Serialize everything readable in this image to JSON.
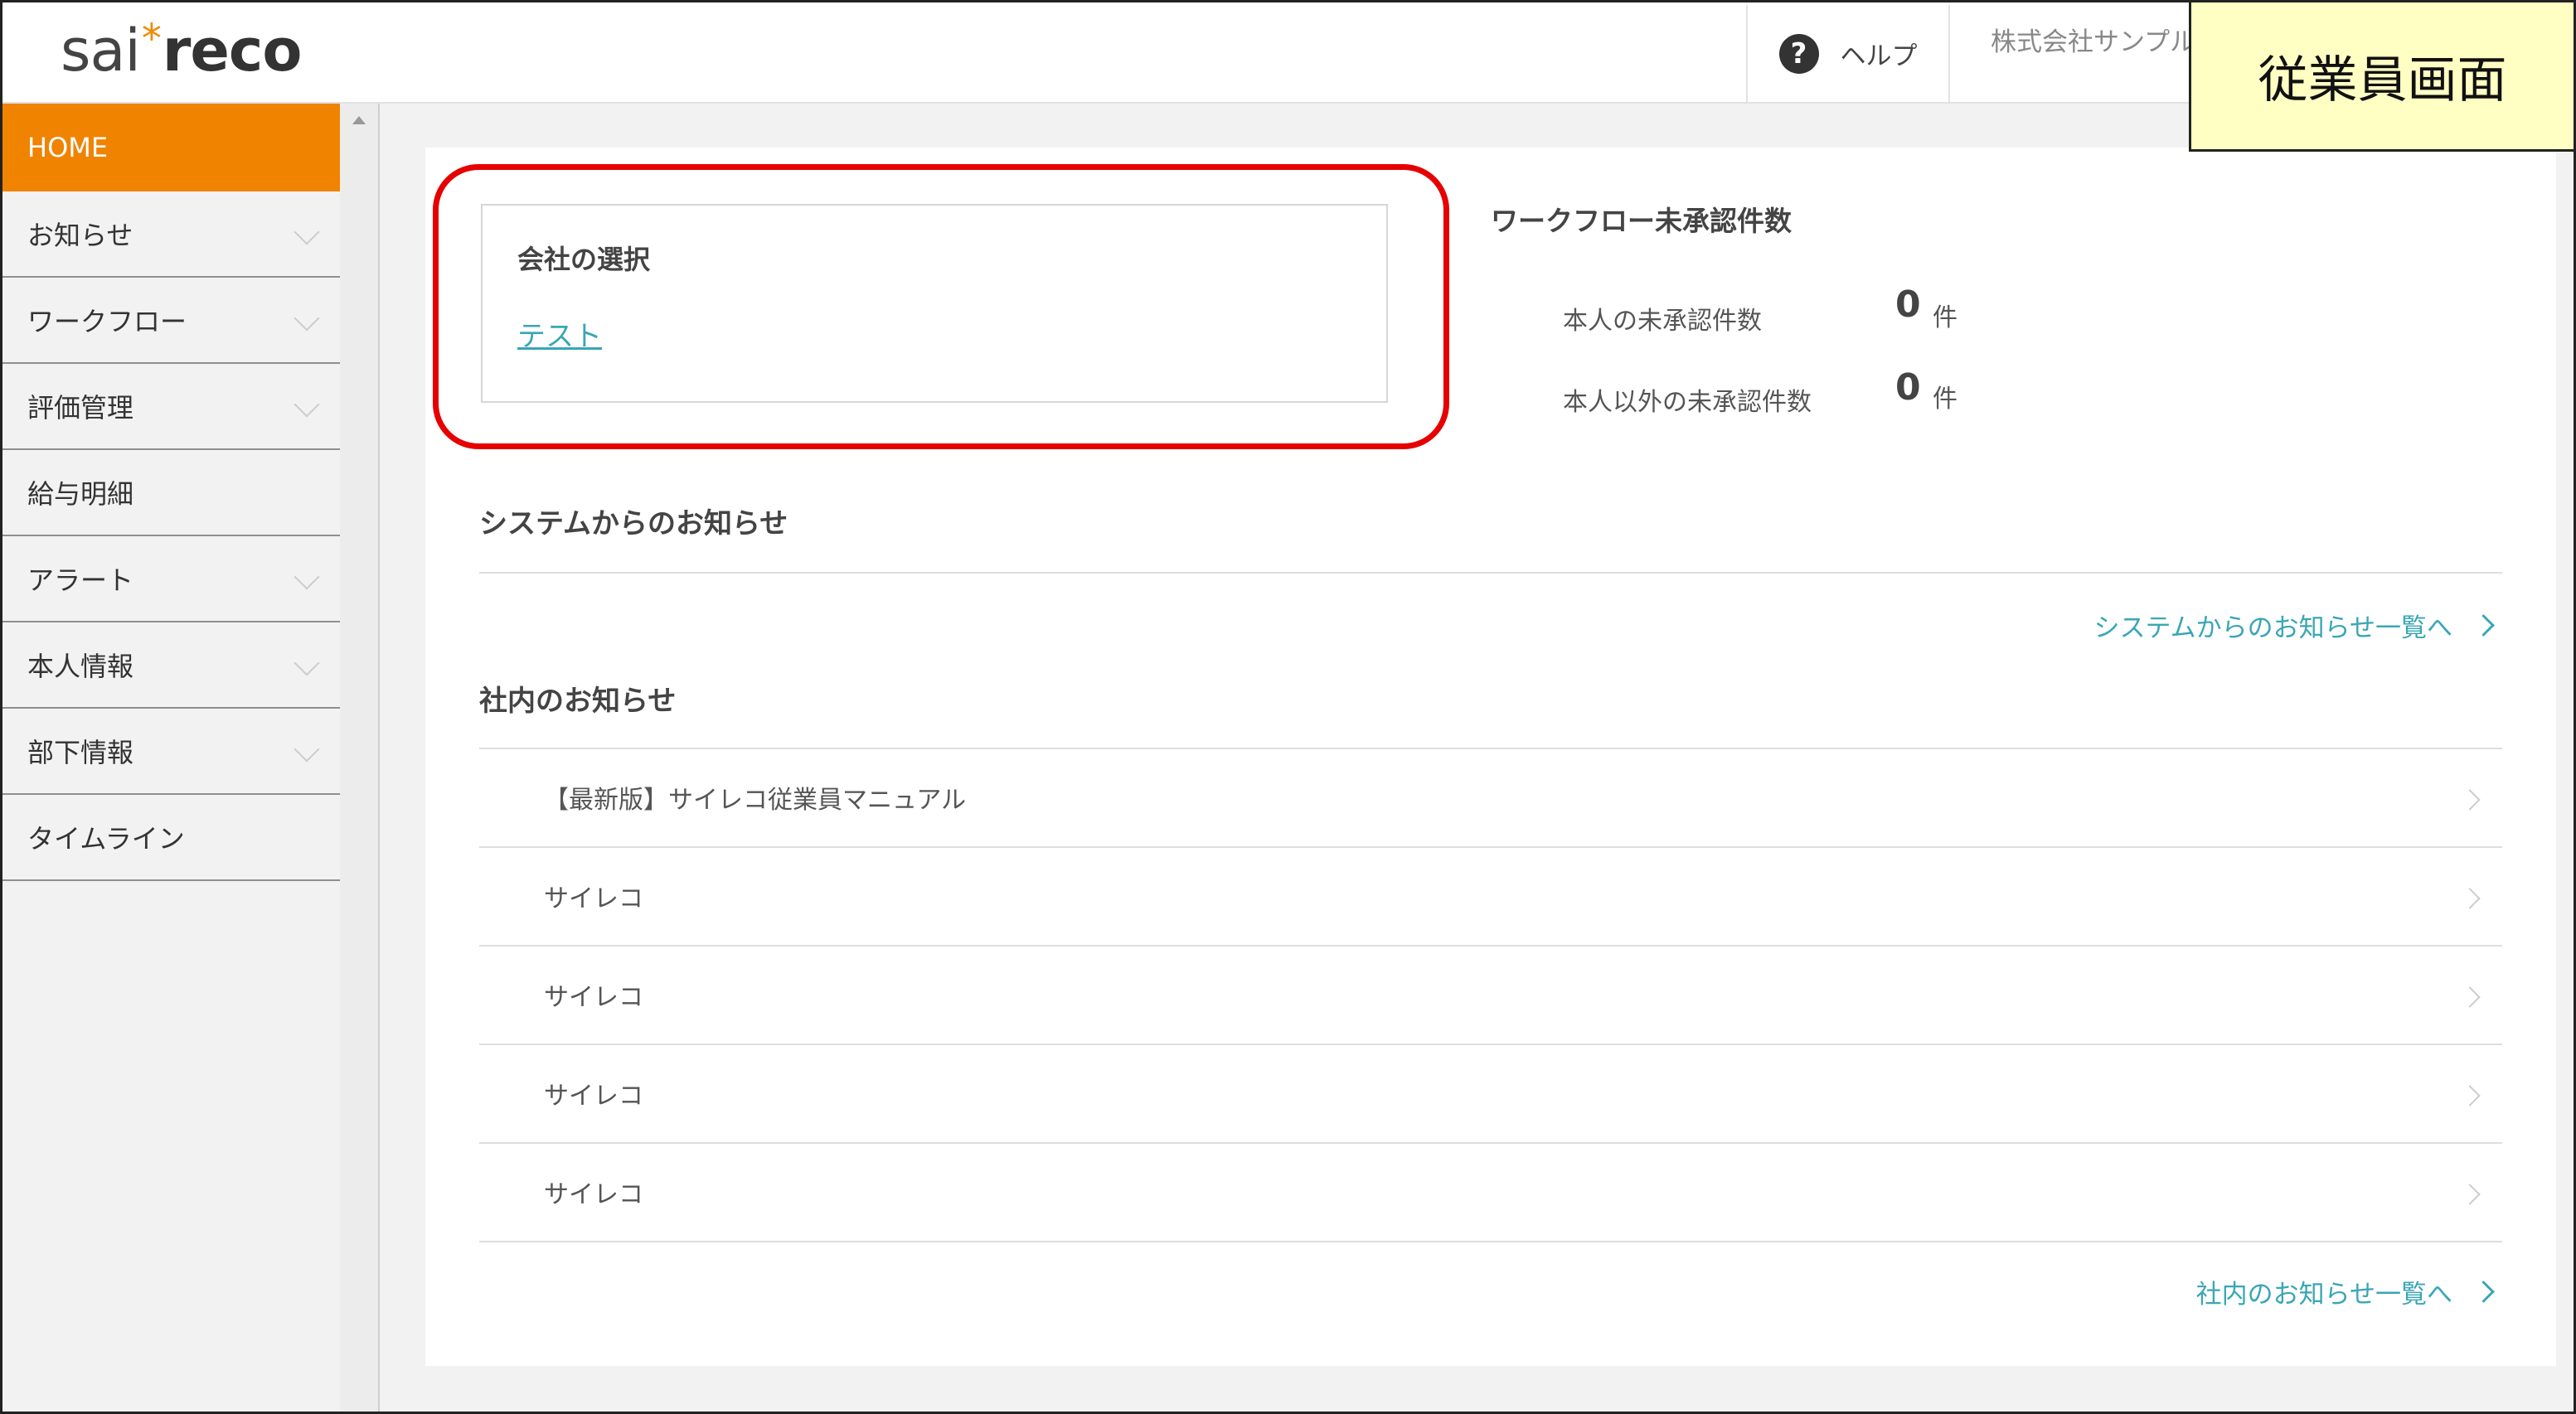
{
  "header": {
    "logo_part1": "sai",
    "logo_star": "*",
    "logo_part2": "reco",
    "help_label": "ヘルプ",
    "company_name": "株式会社サンプル",
    "screen_badge": "従業員画面"
  },
  "sidebar": {
    "items": [
      {
        "label": "HOME",
        "active": true
      },
      {
        "label": "お知らせ",
        "expandable": true
      },
      {
        "label": "ワークフロー",
        "expandable": true
      },
      {
        "label": "評価管理",
        "expandable": true
      },
      {
        "label": "給与明細",
        "expandable": false
      },
      {
        "label": "アラート",
        "expandable": true
      },
      {
        "label": "本人情報",
        "expandable": true
      },
      {
        "label": "部下情報",
        "expandable": true
      },
      {
        "label": "タイムライン",
        "expandable": false
      }
    ]
  },
  "company_select": {
    "title": "会社の選択",
    "company_link": "テスト"
  },
  "workflow": {
    "title": "ワークフロー未承認件数",
    "self_label": "本人の未承認件数",
    "self_count": "0",
    "others_label": "本人以外の未承認件数",
    "others_count": "0",
    "unit": "件"
  },
  "system_notices": {
    "title": "システムからのお知らせ",
    "more_link": "システムからのお知らせ一覧へ"
  },
  "internal_notices": {
    "title": "社内のお知らせ",
    "items": [
      "【最新版】サイレコ従業員マニュアル",
      "サイレコ",
      "サイレコ",
      "サイレコ",
      "サイレコ"
    ],
    "more_link": "社内のお知らせ一覧へ"
  },
  "colors": {
    "accent": "#f08300",
    "link": "#3aa6b5",
    "highlight": "#e60000",
    "badge_bg": "#ffffc4"
  }
}
